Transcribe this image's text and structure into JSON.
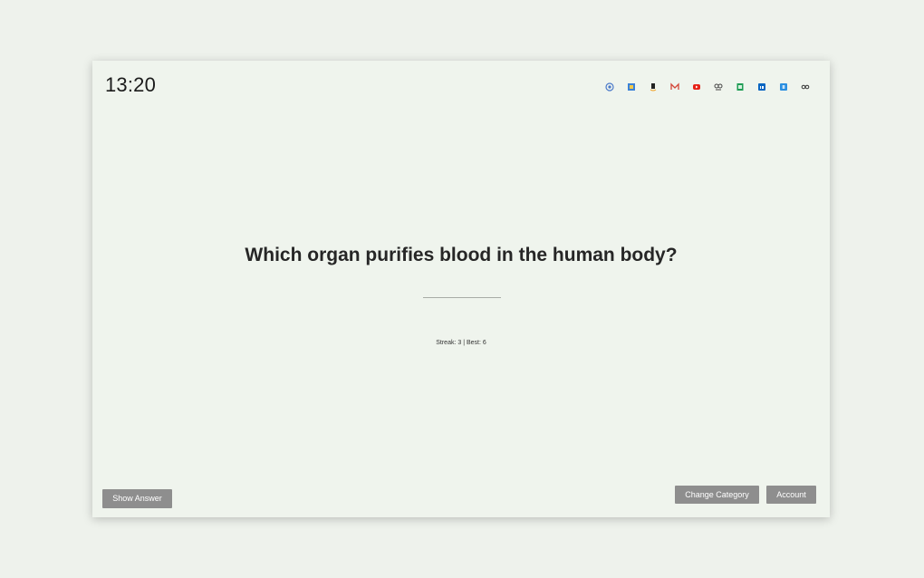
{
  "clock": {
    "time": "13:20"
  },
  "shortcuts": [
    {
      "icon": "chrome-icon",
      "color": "#4a79c9"
    },
    {
      "icon": "google-drive-icon",
      "color": "#3b82d8"
    },
    {
      "icon": "amazon-icon",
      "color": "#222222"
    },
    {
      "icon": "gmail-icon",
      "color": "#d44638"
    },
    {
      "icon": "youtube-icon",
      "color": "#e62117"
    },
    {
      "icon": "goodreads-icon",
      "color": "#444444"
    },
    {
      "icon": "sheets-icon",
      "color": "#1f9d55"
    },
    {
      "icon": "linkedin-icon",
      "color": "#0a66c2"
    },
    {
      "icon": "dropbox-icon",
      "color": "#2b8fe0"
    },
    {
      "icon": "glasses-icon",
      "color": "#333333"
    }
  ],
  "quiz": {
    "question": "Which organ purifies blood in the human body?",
    "score": "Streak: 3 | Best: 6"
  },
  "buttons": {
    "show_answer": "Show Answer",
    "change_category": "Change Category",
    "account": "Account"
  },
  "colors": {
    "background": "#eef2ec",
    "panel": "#eff4ed",
    "button": "#8e8e8e"
  }
}
